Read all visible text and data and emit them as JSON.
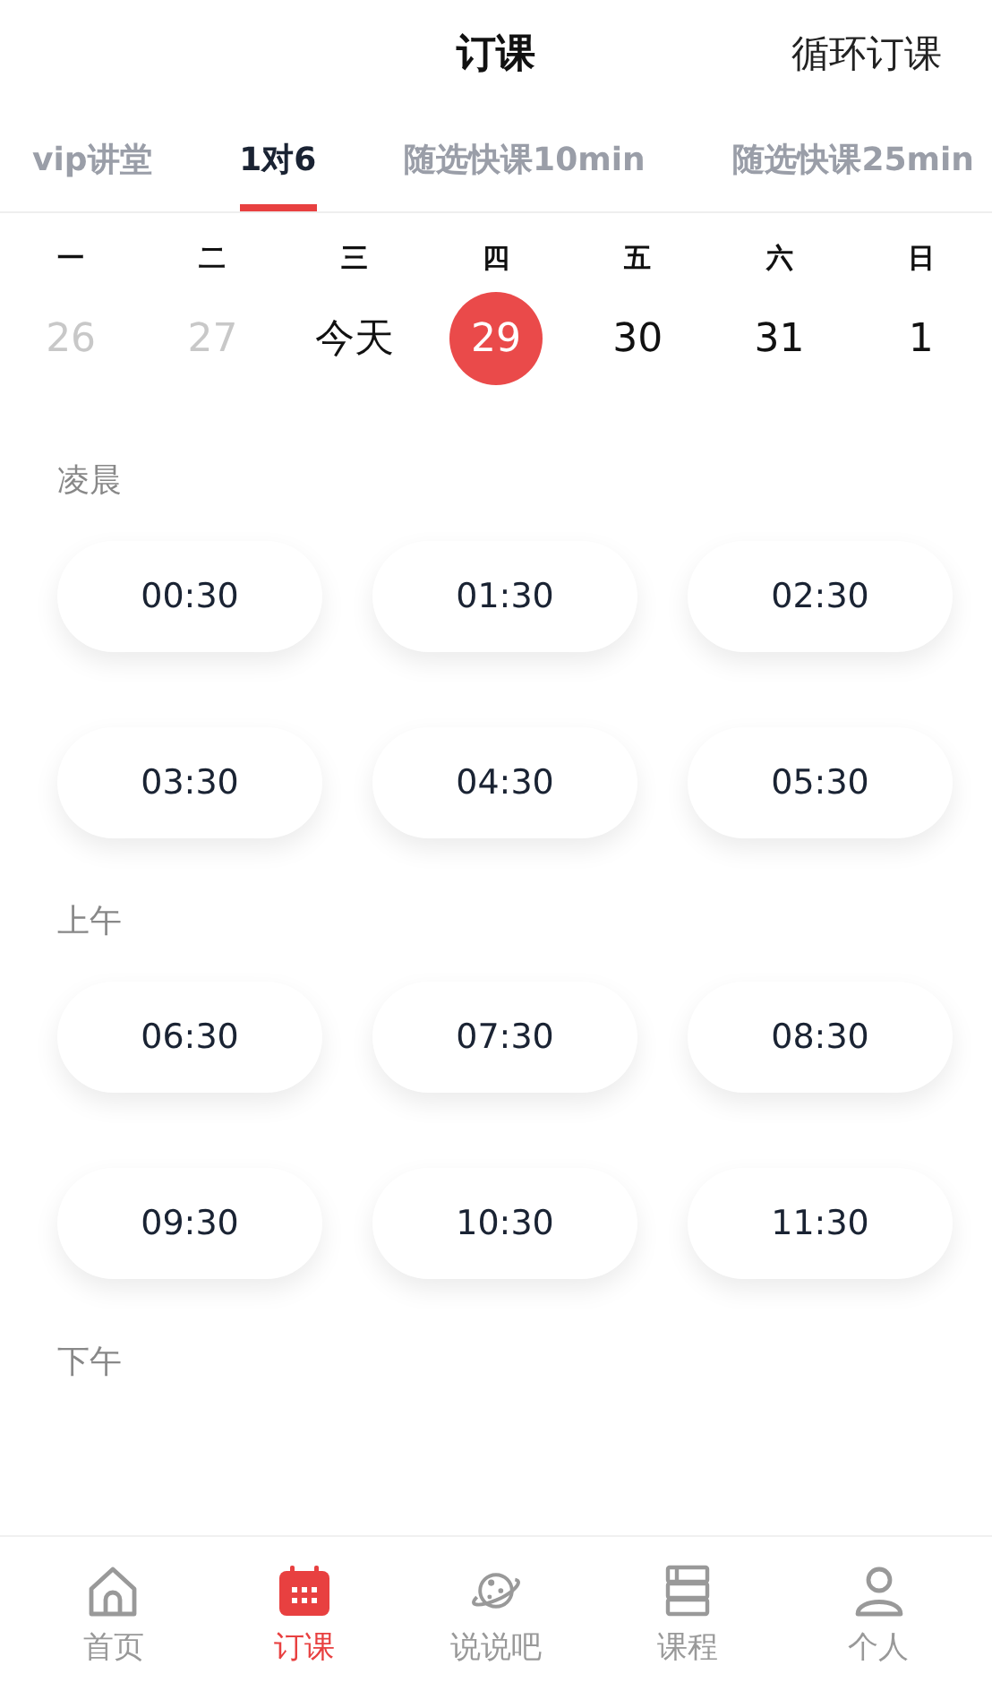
{
  "header": {
    "title": "订课",
    "action": "循环订课"
  },
  "tabs": [
    {
      "label": "vip讲堂",
      "selected": false
    },
    {
      "label": "1对6",
      "selected": true
    },
    {
      "label": "随选快课10min",
      "selected": false
    },
    {
      "label": "随选快课25min",
      "selected": false
    }
  ],
  "week": {
    "weekdays": [
      "一",
      "二",
      "三",
      "四",
      "五",
      "六",
      "日"
    ],
    "dates": [
      {
        "label": "26",
        "past": true,
        "selected": false
      },
      {
        "label": "27",
        "past": true,
        "selected": false
      },
      {
        "label": "今天",
        "past": false,
        "selected": false
      },
      {
        "label": "29",
        "past": false,
        "selected": true
      },
      {
        "label": "30",
        "past": false,
        "selected": false
      },
      {
        "label": "31",
        "past": false,
        "selected": false
      },
      {
        "label": "1",
        "past": false,
        "selected": false
      }
    ]
  },
  "sections": [
    {
      "title": "凌晨",
      "slots": [
        "00:30",
        "01:30",
        "02:30",
        "03:30",
        "04:30",
        "05:30"
      ]
    },
    {
      "title": "上午",
      "slots": [
        "06:30",
        "07:30",
        "08:30",
        "09:30",
        "10:30",
        "11:30"
      ]
    },
    {
      "title": "下午"
    }
  ],
  "bottom_nav": [
    {
      "kind": "home",
      "label": "首页",
      "selected": false
    },
    {
      "kind": "calendar",
      "label": "订课",
      "selected": true
    },
    {
      "kind": "planet",
      "label": "说说吧",
      "selected": false
    },
    {
      "kind": "books",
      "label": "课程",
      "selected": false
    },
    {
      "kind": "person",
      "label": "个人",
      "selected": false
    }
  ]
}
